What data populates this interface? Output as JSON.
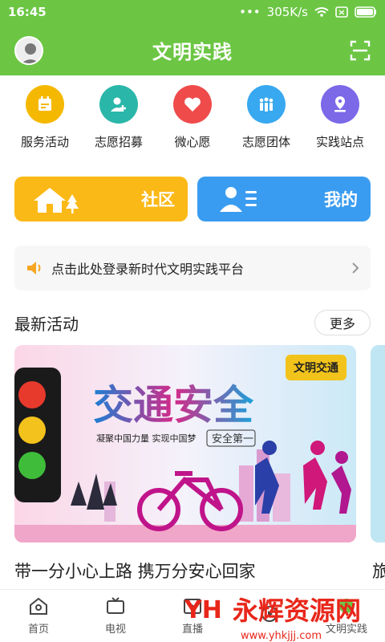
{
  "statusbar": {
    "time": "16:45",
    "network_speed": "305K/s",
    "icons": [
      "signal-dots-icon",
      "wifi-icon",
      "sim-icon",
      "battery-icon"
    ]
  },
  "header": {
    "title": "文明实践",
    "left_icon": "avatar",
    "right_icon": "scan-icon",
    "bg": "#6cc644"
  },
  "quick_actions": [
    {
      "label": "服务活动",
      "icon": "calendar-icon",
      "color": "#f5b800"
    },
    {
      "label": "志愿招募",
      "icon": "user-add-icon",
      "color": "#2ab7a9"
    },
    {
      "label": "微心愿",
      "icon": "heart-icon",
      "color": "#ef4b4b"
    },
    {
      "label": "志愿团体",
      "icon": "group-icon",
      "color": "#38a8f0"
    },
    {
      "label": "实践站点",
      "icon": "location-pin-icon",
      "color": "#7b69e8"
    }
  ],
  "cards": [
    {
      "label": "社区",
      "icon": "house-icon",
      "color": "#fbb917"
    },
    {
      "label": "我的",
      "icon": "profile-card-icon",
      "color": "#3a9cf0"
    }
  ],
  "notice": {
    "text": "点击此处登录新时代文明实践平台",
    "icon": "speaker-icon",
    "chevron": "chevron-right-icon"
  },
  "latest": {
    "title": "最新活动",
    "more_label": "更多"
  },
  "banner": {
    "tag": "文明交通",
    "headline": "交通安全",
    "slogan": "凝聚中国力量 实现中国梦",
    "stamp": "安全第一",
    "caption": "带一分小心上路 携万分安心回家",
    "next_caption": "旅"
  },
  "tabbar": {
    "tabs": [
      {
        "label": "首页",
        "icon": "home-icon"
      },
      {
        "label": "电视",
        "icon": "tv-icon"
      },
      {
        "label": "直播",
        "icon": "live-icon"
      },
      {
        "label": "",
        "icon": "play-icon"
      },
      {
        "label": "文明实践",
        "icon": "practice-icon"
      }
    ]
  },
  "watermark": {
    "text": "永辉资源网",
    "url": "www.yhkjjj.com"
  }
}
